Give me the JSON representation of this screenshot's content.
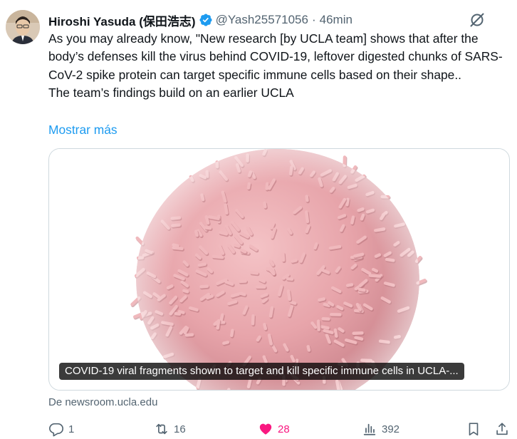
{
  "tweet": {
    "author_name": "Hiroshi Yasuda (保田浩志)",
    "handle": "@Yash25571056",
    "separator": "·",
    "time": "46min",
    "text_lines": [
      "As you may already know, \"New research [by UCLA team] shows that after the body’s defenses kill the virus behind COVID-19, leftover digested chunks of SARS-CoV-2 spike protein can target specific immune cells based on their shape..",
      "The team’s findings build on an earlier UCLA"
    ],
    "show_more": "Mostrar más",
    "card": {
      "caption": "COVID-19 viral fragments shown to target and kill specific immune cells in UCLA-...",
      "source": "De newsroom.ucla.edu"
    },
    "actions": {
      "replies": "1",
      "reposts": "16",
      "likes": "28",
      "views": "392"
    }
  },
  "colors": {
    "link": "#1d9bf0",
    "verified": "#1d9bf0",
    "like": "#f91880",
    "muted": "#536471",
    "virus": "#e7a8ae"
  },
  "icons": [
    "verified-badge-icon",
    "grok-icon",
    "reply-icon",
    "repost-icon",
    "heart-icon",
    "views-icon",
    "bookmark-icon",
    "share-icon"
  ]
}
